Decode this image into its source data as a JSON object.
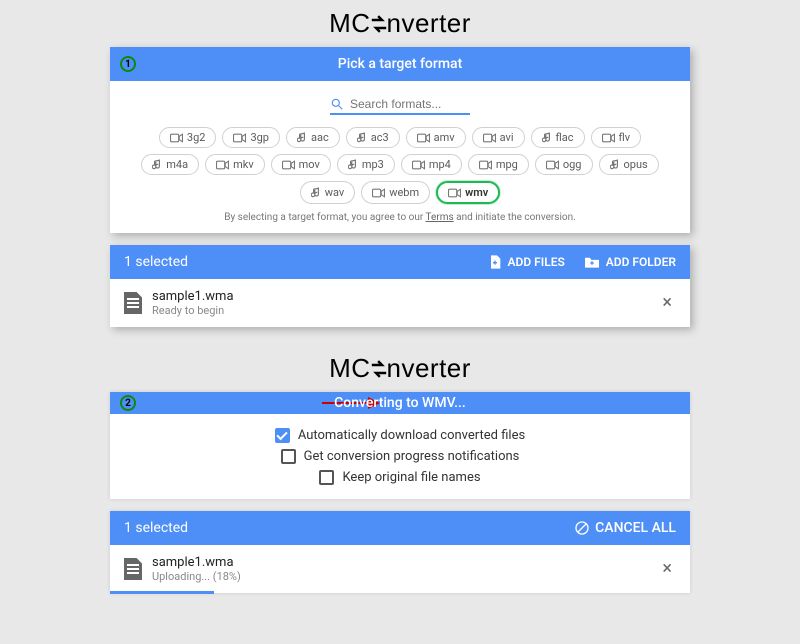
{
  "logo_parts": {
    "pre": "MC",
    "post": "nverter"
  },
  "step1": {
    "title": "Pick a target format",
    "search_placeholder": "Search formats...",
    "formats": [
      {
        "label": "3g2",
        "icon": "video"
      },
      {
        "label": "3gp",
        "icon": "video"
      },
      {
        "label": "aac",
        "icon": "audio"
      },
      {
        "label": "ac3",
        "icon": "audio"
      },
      {
        "label": "amv",
        "icon": "video"
      },
      {
        "label": "avi",
        "icon": "video"
      },
      {
        "label": "flac",
        "icon": "audio"
      },
      {
        "label": "flv",
        "icon": "video"
      },
      {
        "label": "m4a",
        "icon": "audio"
      },
      {
        "label": "mkv",
        "icon": "video"
      },
      {
        "label": "mov",
        "icon": "video"
      },
      {
        "label": "mp3",
        "icon": "audio"
      },
      {
        "label": "mp4",
        "icon": "video"
      },
      {
        "label": "mpg",
        "icon": "video"
      },
      {
        "label": "ogg",
        "icon": "video"
      },
      {
        "label": "opus",
        "icon": "audio"
      },
      {
        "label": "wav",
        "icon": "audio"
      },
      {
        "label": "webm",
        "icon": "video"
      },
      {
        "label": "wmv",
        "icon": "video",
        "selected": true
      }
    ],
    "fineprint_pre": "By selecting a target format, you agree to our ",
    "fineprint_link": "Terms",
    "fineprint_post": " and initiate the conversion."
  },
  "selected_bar": {
    "text": "1 selected",
    "add_files": "ADD FILES",
    "add_folder": "ADD FOLDER"
  },
  "file1": {
    "name": "sample1.wma",
    "status": "Ready to begin"
  },
  "step2": {
    "title": "Converting to WMV...",
    "opt1": "Automatically download converted files",
    "opt2": "Get conversion progress notifications",
    "opt3": "Keep original file names"
  },
  "selected_bar2": {
    "text": "1 selected",
    "cancel": "CANCEL ALL"
  },
  "file2": {
    "name": "sample1.wma",
    "status": "Uploading... (18%)",
    "progress": 18
  }
}
